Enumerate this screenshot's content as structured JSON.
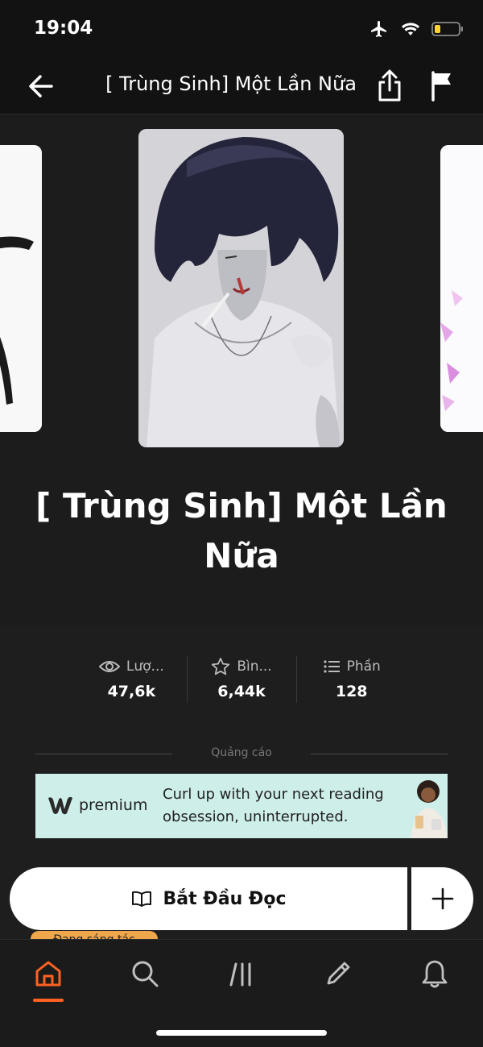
{
  "status_bar": {
    "time": "19:04"
  },
  "nav": {
    "title": "[ Trùng Sinh] Một Lần Nữa"
  },
  "book": {
    "title": "[ Trùng Sinh] Một Lần Nữa"
  },
  "stats": [
    {
      "icon": "eye-icon",
      "label": "Lượ...",
      "value": "47,6k"
    },
    {
      "icon": "star-icon",
      "label": "Bìn...",
      "value": "6,44k"
    },
    {
      "icon": "list-icon",
      "label": "Phần",
      "value": "128"
    }
  ],
  "ad": {
    "label": "Quảng cáo",
    "logo_text": "premium",
    "copy": "Curl up with your next reading obsession, uninterrupted."
  },
  "actions": {
    "read_label": "Bắt Đầu Đọc"
  },
  "status_chip": {
    "label": "Đang sáng tác"
  },
  "tabs": [
    {
      "icon": "home-icon",
      "active": true
    },
    {
      "icon": "search-icon",
      "active": false
    },
    {
      "icon": "library-icon",
      "active": false
    },
    {
      "icon": "pencil-icon",
      "active": false
    },
    {
      "icon": "bell-icon",
      "active": false
    }
  ],
  "colors": {
    "accent": "#ff6122",
    "background": "#121212",
    "ad_background": "#cdeee9",
    "chip": "#f0a64a"
  }
}
